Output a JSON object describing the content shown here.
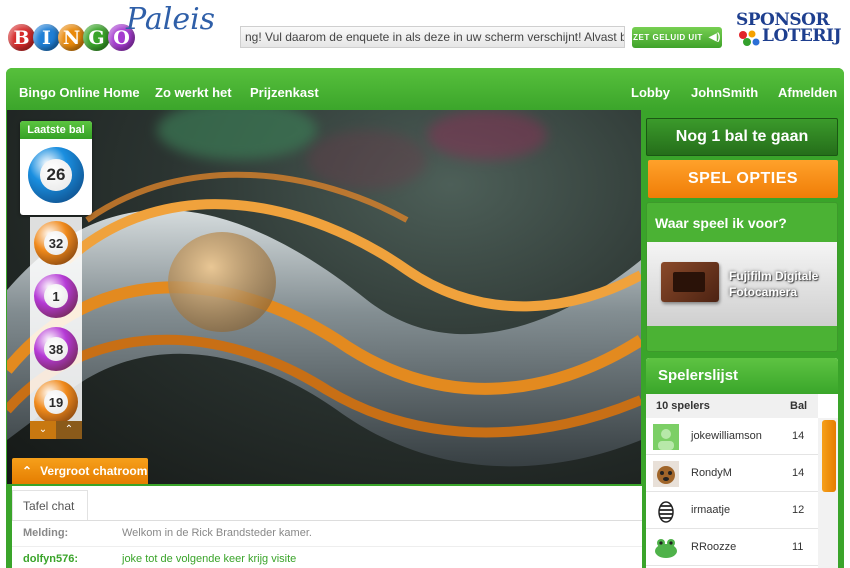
{
  "header": {
    "logo_letters": [
      "B",
      "I",
      "N",
      "G",
      "O"
    ],
    "logo_colors": [
      "#d62a2a",
      "#1f7fd6",
      "#e98a0c",
      "#3aa42a",
      "#a53ad0"
    ],
    "logo_word": "Paleis",
    "ticker": "ng! Vul daarom de enquete in als deze in uw scherm verschijnt! Alvast bedankt!",
    "sound_button": "ZET GELUID UIT",
    "sponsor_line1": "SPONSOR",
    "sponsor_line2": "LOTERIJ"
  },
  "nav": {
    "home": "Bingo Online Home",
    "how": "Zo werkt het",
    "prizes": "Prijzenkast",
    "lobby": "Lobby",
    "user": "JohnSmith",
    "logout": "Afmelden"
  },
  "last_ball": {
    "label": "Laatste bal",
    "number": "26",
    "color": "#1a8fe0"
  },
  "previous_balls": [
    {
      "number": "32",
      "color": "#f08a1c"
    },
    {
      "number": "1",
      "color": "#b53ad6"
    },
    {
      "number": "38",
      "color": "#b53ad6"
    },
    {
      "number": "19",
      "color": "#f08a1c"
    }
  ],
  "chat": {
    "expand_label": "Vergroot chatroom",
    "tab_label": "Tafel chat",
    "messages": [
      {
        "who": "Melding:",
        "text": "Welkom in de Rick Brandsteder kamer.",
        "color": "#888888"
      },
      {
        "who": "dolfyn576:",
        "text": "joke tot de volgende keer krijg visite",
        "color": "#3aa42a"
      }
    ]
  },
  "game": {
    "balls_left": "Nog 1 bal te gaan",
    "options": "SPEL OPTIES",
    "prize_title": "Waar speel ik voor?",
    "prize_name": "Fujifilm Digitale Fotocamera"
  },
  "players": {
    "title": "Spelerslijst",
    "count_label": "10 spelers",
    "ball_header": "Bal",
    "list": [
      {
        "name": "jokewilliamson",
        "ball": "14",
        "avatar": "avatar-default"
      },
      {
        "name": "RondyM",
        "ball": "14",
        "avatar": "avatar-dog"
      },
      {
        "name": "irmaatje",
        "ball": "12",
        "avatar": "avatar-zebra"
      },
      {
        "name": "RRoozze",
        "ball": "11",
        "avatar": "avatar-frog"
      }
    ]
  }
}
